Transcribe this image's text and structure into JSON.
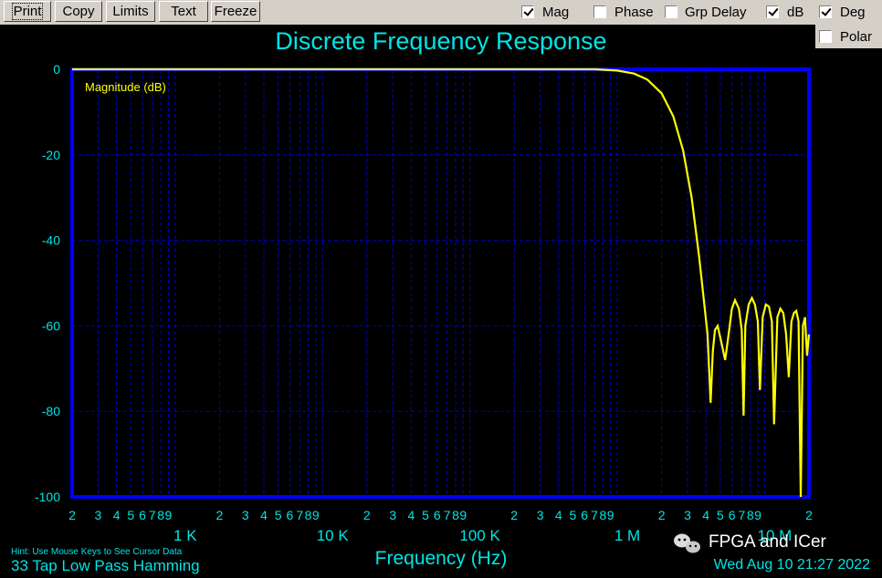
{
  "toolbar": {
    "buttons": [
      "Print",
      "Copy",
      "Limits",
      "Text",
      "Freeze"
    ],
    "checkboxes": [
      {
        "label": "Mag",
        "checked": true
      },
      {
        "label": "Phase",
        "checked": false
      },
      {
        "label": "Grp Delay",
        "checked": false
      },
      {
        "label": "dB",
        "checked": true
      },
      {
        "label": "Deg",
        "checked": true
      },
      {
        "label": "Polar",
        "checked": false
      }
    ]
  },
  "footer": {
    "hint": "Hint: Use Mouse Keys to See Cursor Data",
    "filter_label": "33 Tap Low Pass Hamming",
    "timestamp": "Wed Aug 10 21:27 2022",
    "watermark": "FPGA and ICer"
  },
  "colors": {
    "background": "#000000",
    "title": "#00e5e5",
    "axis_frame": "#0000ff",
    "grid": "#0000cc",
    "trace": "#ffff00",
    "tick_labels": "#00e5e5"
  },
  "chart_data": {
    "type": "line",
    "title": "Discrete Frequency Response",
    "xlabel": "Frequency (Hz)",
    "ylabel": "Magnitude (dB)",
    "x_scale": "log",
    "xlim": [
      200,
      20000000
    ],
    "ylim": [
      -100,
      0
    ],
    "yticks": [
      0,
      -20,
      -40,
      -60,
      -80,
      -100
    ],
    "x_minor_labels": [
      "2",
      "3",
      "4",
      "5",
      "6",
      "7",
      "8",
      "9",
      "2",
      "3",
      "4",
      "5",
      "6",
      "7",
      "8",
      "9",
      "2",
      "3",
      "4",
      "5",
      "6",
      "7",
      "8",
      "9",
      "2",
      "3",
      "4",
      "5",
      "6",
      "7",
      "8",
      "9",
      "2",
      "3",
      "4",
      "5",
      "6",
      "7",
      "8",
      "9",
      "2"
    ],
    "x_decade_labels": [
      {
        "label": "1 K",
        "value": 1000
      },
      {
        "label": "10 K",
        "value": 10000
      },
      {
        "label": "100 K",
        "value": 100000
      },
      {
        "label": "1 M",
        "value": 1000000
      },
      {
        "label": "10 M",
        "value": 10000000
      }
    ],
    "grid": true,
    "series": [
      {
        "values": [
          [
            200,
            0
          ],
          [
            100000,
            0
          ],
          [
            500000,
            0
          ],
          [
            700000,
            0
          ],
          [
            1000000,
            -0.3
          ],
          [
            1300000,
            -1.0
          ],
          [
            1600000,
            -2.4
          ],
          [
            2000000,
            -5.6
          ],
          [
            2400000,
            -11
          ],
          [
            2800000,
            -19
          ],
          [
            3200000,
            -30
          ],
          [
            3600000,
            -44
          ],
          [
            3900000,
            -55
          ],
          [
            4100000,
            -62
          ],
          [
            4300000,
            -78
          ],
          [
            4450000,
            -66
          ],
          [
            4600000,
            -61
          ],
          [
            4800000,
            -60
          ],
          [
            5100000,
            -64
          ],
          [
            5400000,
            -68
          ],
          [
            5700000,
            -62
          ],
          [
            6000000,
            -56
          ],
          [
            6300000,
            -54
          ],
          [
            6700000,
            -56
          ],
          [
            7000000,
            -61
          ],
          [
            7200000,
            -81
          ],
          [
            7400000,
            -60
          ],
          [
            7800000,
            -55
          ],
          [
            8200000,
            -53.5
          ],
          [
            8600000,
            -55
          ],
          [
            9000000,
            -59
          ],
          [
            9300000,
            -75
          ],
          [
            9700000,
            -58
          ],
          [
            10200000,
            -55
          ],
          [
            10700000,
            -55.5
          ],
          [
            11200000,
            -59
          ],
          [
            11600000,
            -83
          ],
          [
            12200000,
            -58
          ],
          [
            12800000,
            -56
          ],
          [
            13400000,
            -57
          ],
          [
            14000000,
            -62
          ],
          [
            14600000,
            -72
          ],
          [
            15200000,
            -59
          ],
          [
            15800000,
            -57
          ],
          [
            16400000,
            -56.5
          ],
          [
            17000000,
            -59
          ],
          [
            17600000,
            -100
          ],
          [
            18200000,
            -60
          ],
          [
            18800000,
            -58
          ],
          [
            19400000,
            -67
          ],
          [
            20000000,
            -62
          ]
        ]
      }
    ]
  }
}
